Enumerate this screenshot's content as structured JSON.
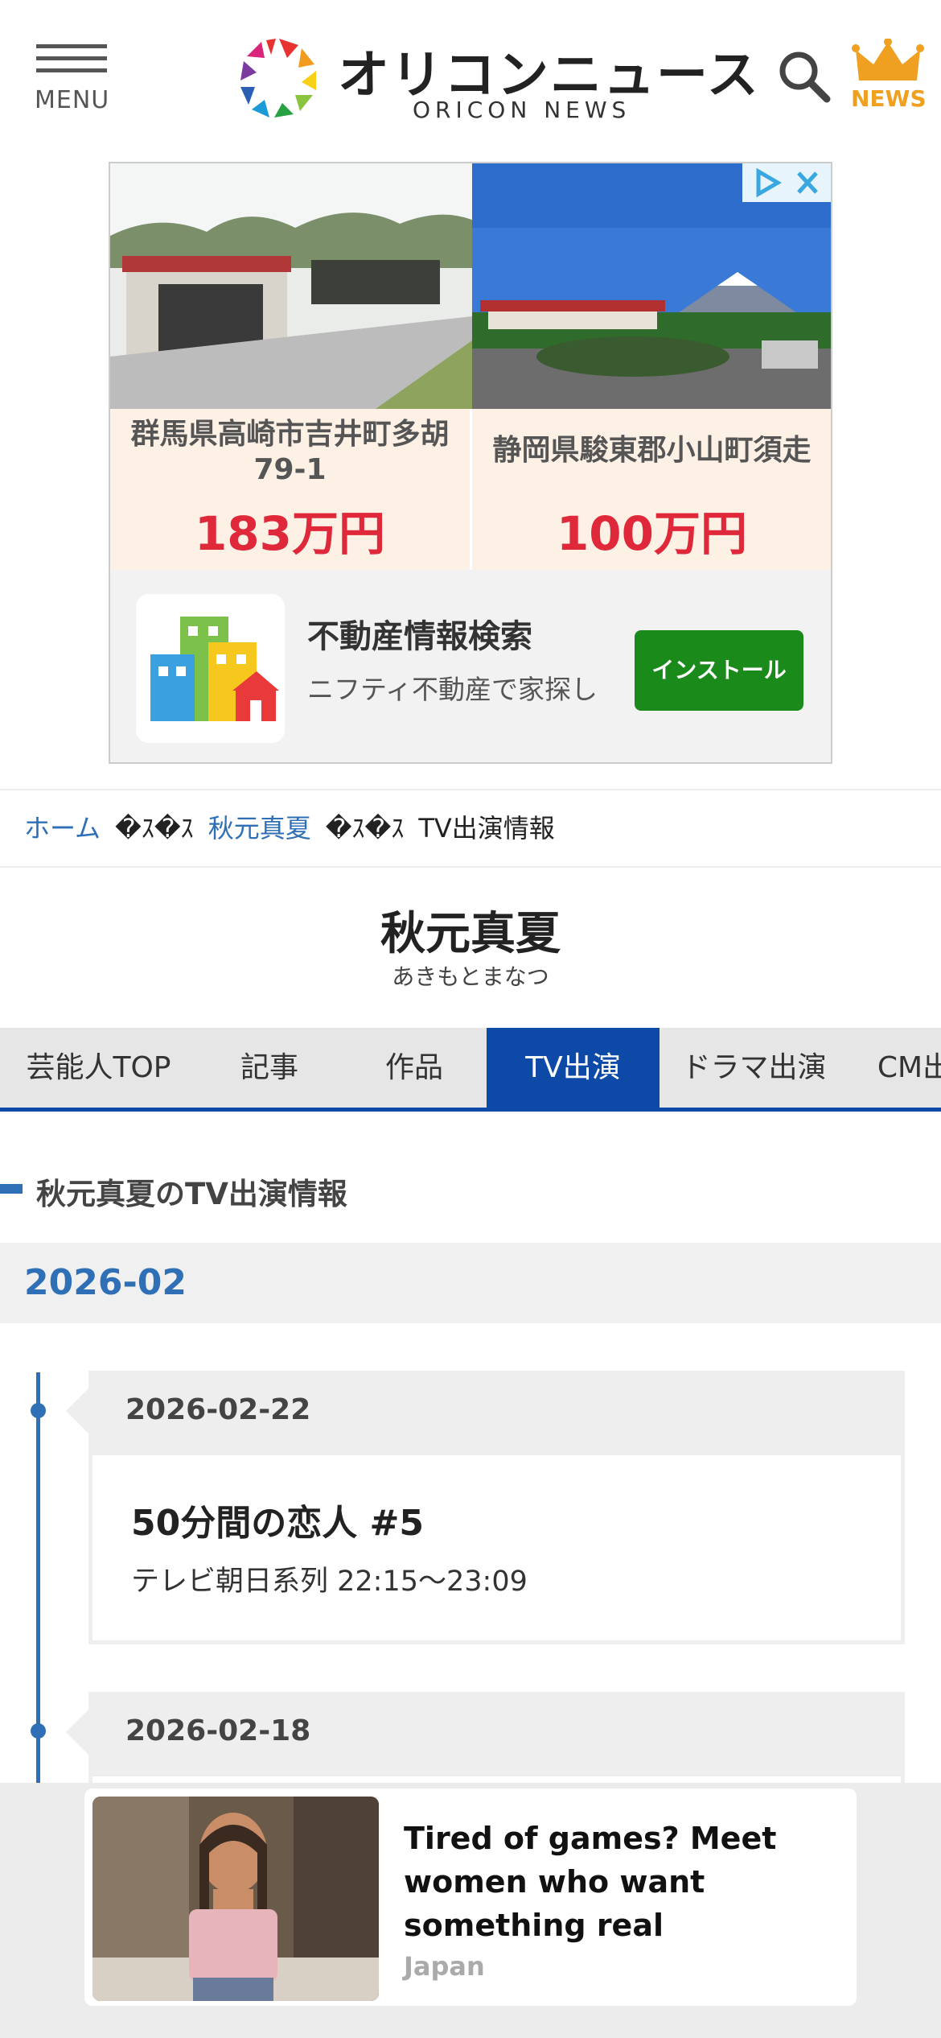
{
  "header": {
    "menu_label": "MENU",
    "logo_title": "オリコンニュース",
    "logo_sub": "ORICON NEWS",
    "news_label": "NEWS"
  },
  "ad": {
    "listings": [
      {
        "address": "群馬県高崎市吉井町多胡79-1",
        "price": "183万円"
      },
      {
        "address": "静岡県駿東郡小山町須走",
        "price": "100万円"
      }
    ],
    "app_title": "不動産情報検索",
    "app_desc": "ニフティ不動産で家探し",
    "install_label": "インストール"
  },
  "breadcrumb": {
    "home": "ホーム",
    "separator": "�ｽ�ｽ",
    "celebrity": "秋元真夏",
    "current": "TV出演情報"
  },
  "celebrity": {
    "name": "秋元真夏",
    "reading": "あきもとまなつ"
  },
  "tabs": [
    {
      "label": "芸能人TOP",
      "active": false
    },
    {
      "label": "記事",
      "active": false
    },
    {
      "label": "作品",
      "active": false
    },
    {
      "label": "TV出演",
      "active": true
    },
    {
      "label": "ドラマ出演",
      "active": false
    },
    {
      "label": "CM出演",
      "active": false
    }
  ],
  "section_title": "秋元真夏のTV出演情報",
  "month": "2026-02",
  "entries": [
    {
      "date": "2026-02-22",
      "title": "50分間の恋人 #5",
      "channel": "テレビ朝日系列 22:15〜23:09"
    },
    {
      "date": "2026-02-18"
    }
  ],
  "promo": {
    "title": "Tired of games? Meet women who want something real",
    "source": "Japan"
  },
  "colors": {
    "accent_blue": "#0d4aa8",
    "link_blue": "#2f6fb5",
    "price_red": "#e0283b",
    "install_green": "#1a8a1a",
    "news_gold": "#f0a020"
  }
}
